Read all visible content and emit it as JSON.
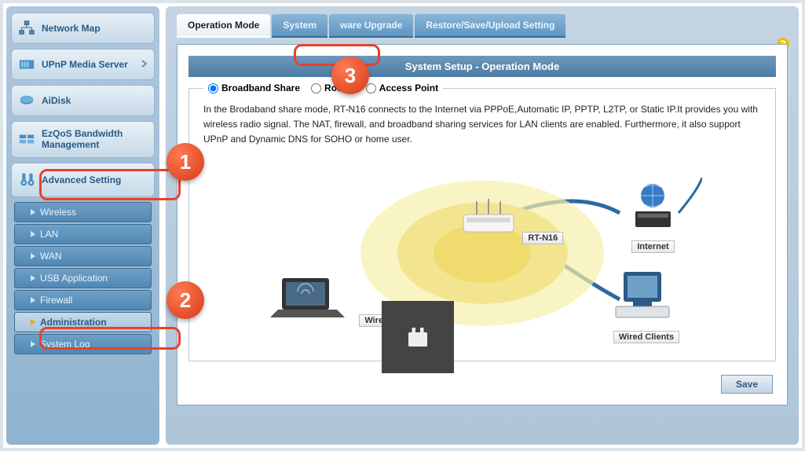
{
  "sidebar": {
    "items": [
      {
        "label": "Network Map"
      },
      {
        "label": "UPnP Media Server"
      },
      {
        "label": "AiDisk"
      },
      {
        "label": "EzQoS Bandwidth Management"
      },
      {
        "label": "Advanced Setting"
      }
    ],
    "subs": [
      {
        "label": "Wireless"
      },
      {
        "label": "LAN"
      },
      {
        "label": "WAN"
      },
      {
        "label": "USB Application"
      },
      {
        "label": "Firewall"
      },
      {
        "label": "Administration"
      },
      {
        "label": "System Log"
      }
    ]
  },
  "tabs": [
    {
      "label": "Operation Mode"
    },
    {
      "label": "System"
    },
    {
      "label": "ware Upgrade"
    },
    {
      "label": "Restore/Save/Upload Setting"
    }
  ],
  "panel": {
    "title": "System Setup - Operation Mode",
    "options": [
      {
        "label": "Broadband Share"
      },
      {
        "label": "Router"
      },
      {
        "label": "Access Point"
      }
    ],
    "selected_option": 0,
    "description": "In the Brodaband share mode, RT-N16 connects to the Internet via PPPoE,Automatic IP, PPTP, L2TP, or Static IP.It provides you with wireless radio signal. The NAT, firewall, and broadband sharing services for LAN clients are enabled. Furthermore, it also support UPnP and Dynamic DNS for SOHO or home user.",
    "diagram": {
      "router": "RT-N16",
      "internet": "Internet",
      "wireless": "Wireless Clients",
      "wired": "Wired Clients"
    },
    "save": "Save"
  },
  "annotations": {
    "b1": "1",
    "b2": "2",
    "b3": "3"
  }
}
